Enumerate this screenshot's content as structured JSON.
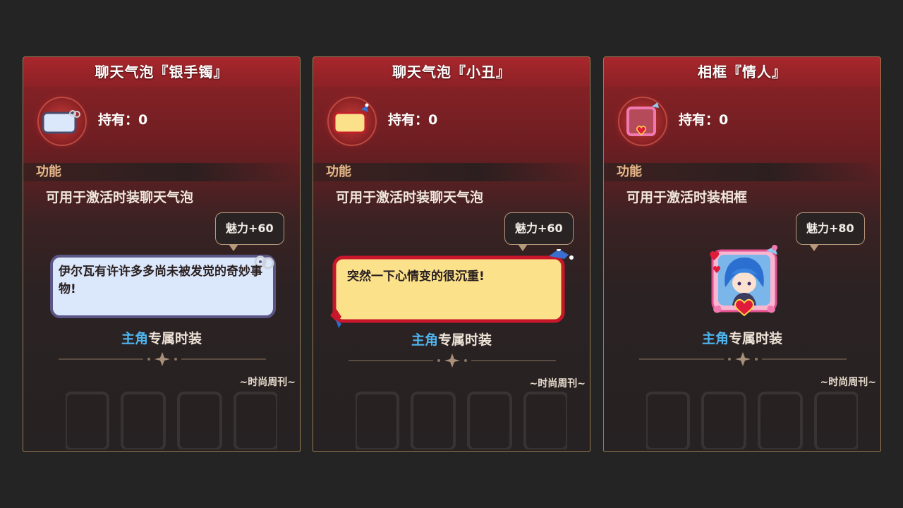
{
  "cards": [
    {
      "title": "聊天气泡『银手镯』",
      "hold_label": "持有：",
      "hold_count": "0",
      "function_label": "功能",
      "description": "可用于激活时装聊天气泡",
      "charm": "魅力+60",
      "preview_text": "伊尔瓦有许许多多尚未被发觉的奇妙事物!",
      "exclusive_highlight": "主角",
      "exclusive_rest": "专属时装",
      "magazine": "~时尚周刊~",
      "icon": "silver-bracelet-bubble-icon"
    },
    {
      "title": "聊天气泡『小丑』",
      "hold_label": "持有：",
      "hold_count": "0",
      "function_label": "功能",
      "description": "可用于激活时装聊天气泡",
      "charm": "魅力+60",
      "preview_text": "突然一下心情变的很沉重!",
      "exclusive_highlight": "主角",
      "exclusive_rest": "专属时装",
      "magazine": "~时尚周刊~",
      "icon": "clown-bubble-icon"
    },
    {
      "title": "相框『情人』",
      "hold_label": "持有：",
      "hold_count": "0",
      "function_label": "功能",
      "description": "可用于激活时装相框",
      "charm": "魅力+80",
      "exclusive_highlight": "主角",
      "exclusive_rest": "专属时装",
      "magazine": "~时尚周刊~",
      "icon": "lover-frame-icon"
    }
  ],
  "colors": {
    "title_bar": "#a8272c",
    "highlight": "#4fb4ee",
    "silver_bubble_fill": "#dbe7fb",
    "clown_bubble_fill": "#fbe18a",
    "frame_pink": "#f07ab0"
  }
}
